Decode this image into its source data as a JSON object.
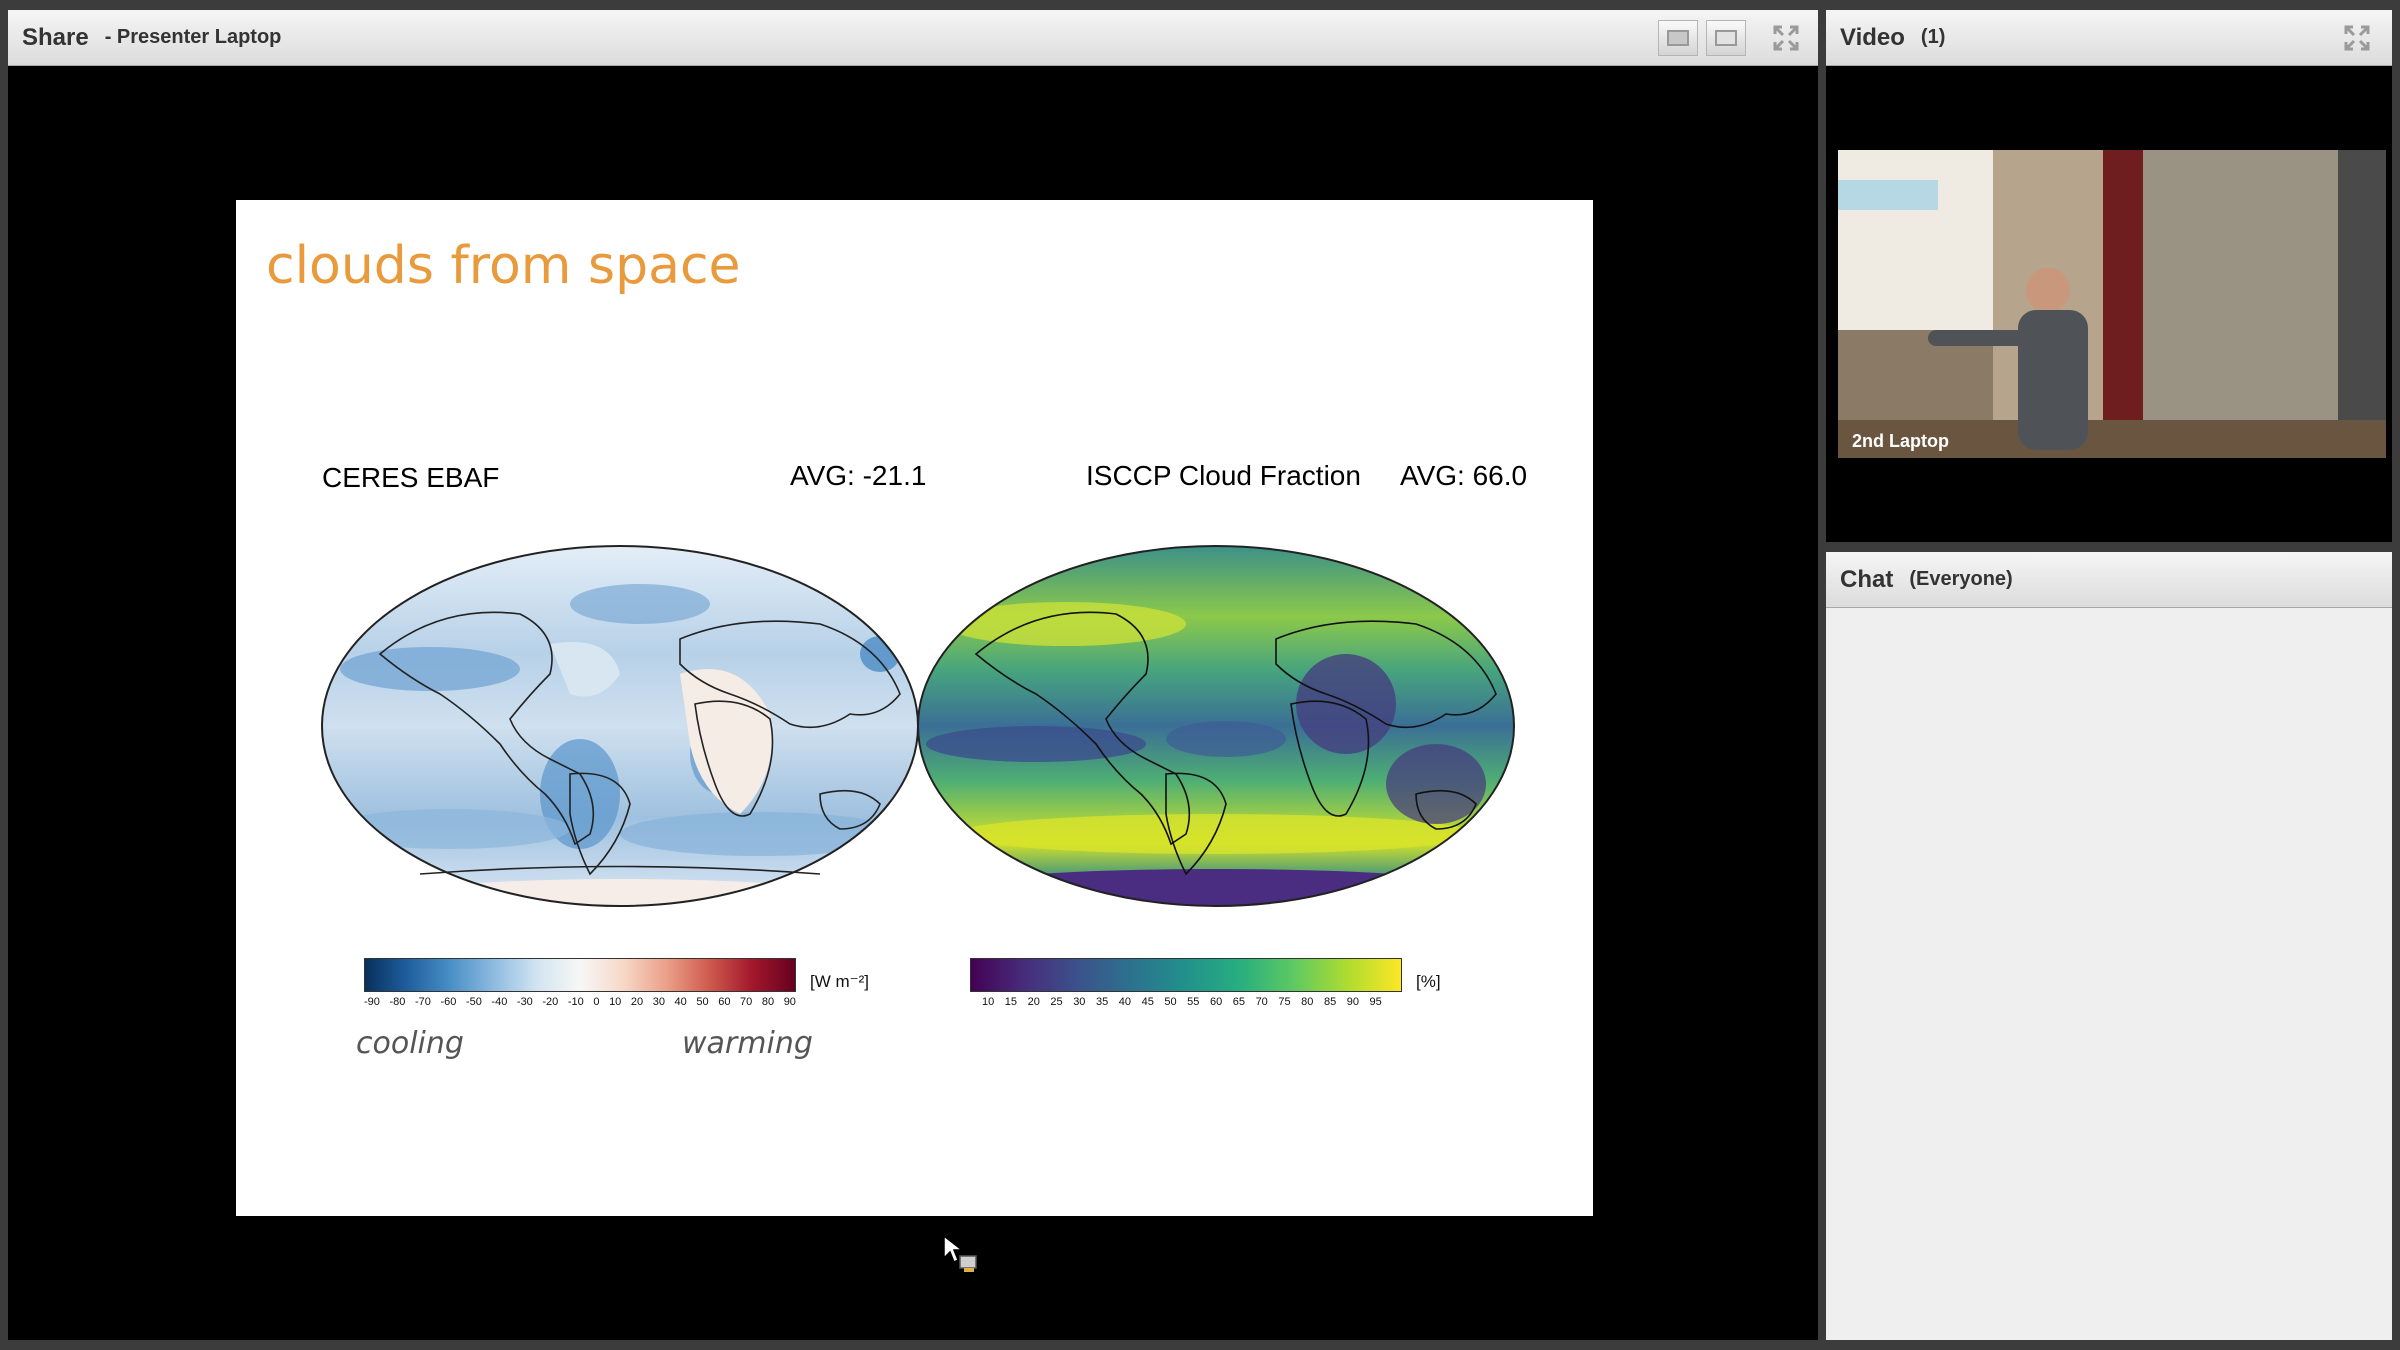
{
  "share_pod": {
    "title": "Share",
    "subtitle": "- Presenter Laptop"
  },
  "slide": {
    "title": "clouds from space",
    "left_map": {
      "name": "CERES EBAF",
      "avg": "AVG: -21.1",
      "colorbar_ticks": [
        "-90",
        "-80",
        "-70",
        "-60",
        "-50",
        "-40",
        "-30",
        "-20",
        "-10",
        "0",
        "10",
        "20",
        "30",
        "40",
        "50",
        "60",
        "70",
        "80",
        "90"
      ],
      "unit": "[W m⁻²]",
      "low_label": "cooling",
      "high_label": "warming"
    },
    "right_map": {
      "name": "ISCCP Cloud Fraction",
      "avg": "AVG: 66.0",
      "colorbar_ticks": [
        "10",
        "15",
        "20",
        "25",
        "30",
        "35",
        "40",
        "45",
        "50",
        "55",
        "60",
        "65",
        "70",
        "75",
        "80",
        "85",
        "90",
        "95"
      ],
      "unit": "[%]"
    }
  },
  "video_pod": {
    "title": "Video",
    "count": "(1)",
    "camera_label": "2nd Laptop"
  },
  "chat_pod": {
    "title": "Chat",
    "audience": "(Everyone)"
  },
  "icons": {
    "layout_a": "layout-single-icon",
    "layout_b": "layout-split-icon",
    "fullscreen": "fullscreen-icon",
    "cursor": "presenter-cursor-icon"
  },
  "colors": {
    "slide_title": "#e89a3c",
    "header_bg": "#e6e6e6",
    "stage_bg": "#000000"
  }
}
